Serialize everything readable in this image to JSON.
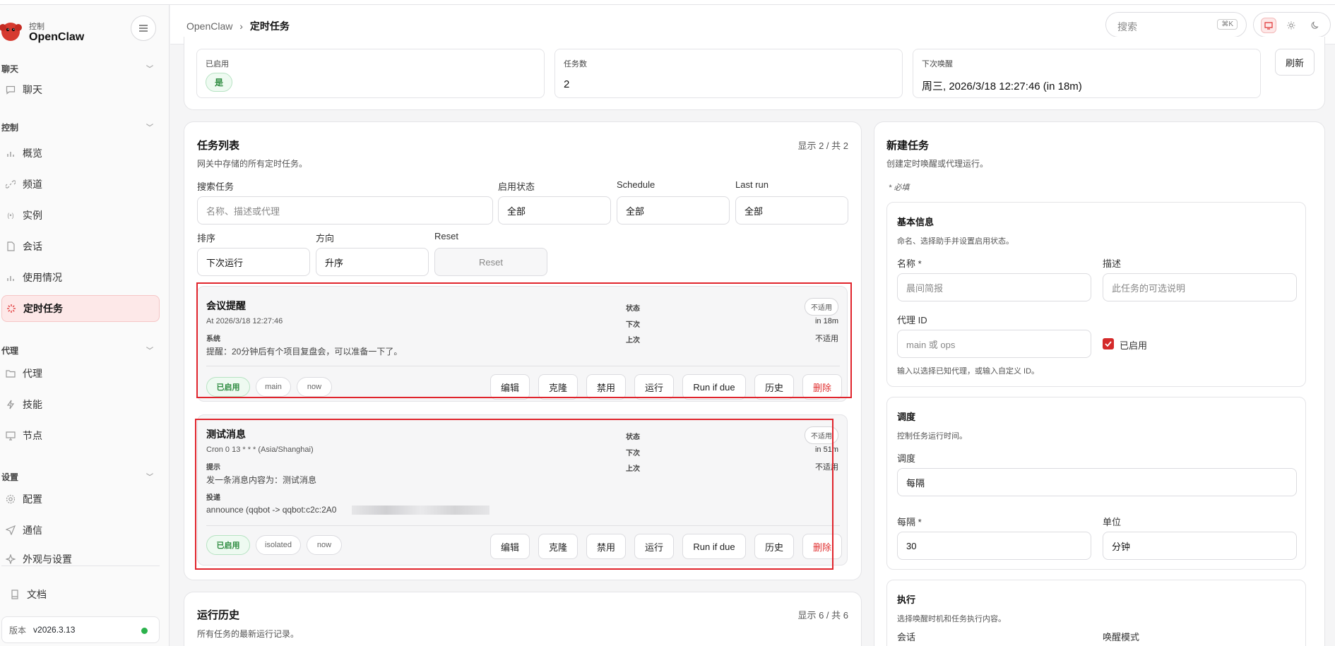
{
  "brand": {
    "sub": "控制",
    "name": "OpenClaw"
  },
  "sidebar": {
    "sections": [
      {
        "label": "聊天",
        "items": [
          {
            "label": "聊天",
            "icon": "chat-icon"
          }
        ]
      },
      {
        "label": "控制",
        "items": [
          {
            "label": "概览",
            "icon": "bar-chart-icon"
          },
          {
            "label": "频道",
            "icon": "link-icon"
          },
          {
            "label": "实例",
            "icon": "broadcast-icon"
          },
          {
            "label": "会话",
            "icon": "document-icon"
          },
          {
            "label": "使用情况",
            "icon": "bar-chart-icon"
          },
          {
            "label": "定时任务",
            "icon": "loader-icon",
            "active": true
          }
        ]
      },
      {
        "label": "代理",
        "items": [
          {
            "label": "代理",
            "icon": "folder-icon"
          },
          {
            "label": "技能",
            "icon": "lightning-icon"
          },
          {
            "label": "节点",
            "icon": "monitor-icon"
          }
        ]
      },
      {
        "label": "设置",
        "items": [
          {
            "label": "配置",
            "icon": "gear-icon"
          },
          {
            "label": "通信",
            "icon": "send-icon"
          },
          {
            "label": "外观与设置",
            "icon": "sparkle-icon"
          }
        ]
      }
    ],
    "docs": "文档",
    "version_label": "版本",
    "version": "v2026.3.13"
  },
  "topbar": {
    "breadcrumb_root": "OpenClaw",
    "breadcrumb_sep": "›",
    "breadcrumb_current": "定时任务",
    "search_placeholder": "搜索",
    "search_shortcut": "⌘K"
  },
  "status": {
    "enabled_label": "已启用",
    "enabled_value": "是",
    "jobs_label": "任务数",
    "jobs_value": "2",
    "next_wake_label": "下次唤醒",
    "next_wake_value": "周三, 2026/3/18 12:27:46 (in 18m)",
    "refresh": "刷新"
  },
  "tasks": {
    "title": "任务列表",
    "subtitle": "网关中存储的所有定时任务。",
    "count": "显示 2 / 共 2",
    "filters": {
      "search_label": "搜索任务",
      "search_placeholder": "名称、描述或代理",
      "enabled_label": "启用状态",
      "enabled_value": "全部",
      "schedule_label": "Schedule",
      "schedule_value": "全部",
      "lastrun_label": "Last run",
      "lastrun_value": "全部",
      "sort_label": "排序",
      "sort_value": "下次运行",
      "dir_label": "方向",
      "dir_value": "升序",
      "reset_label": "Reset",
      "reset_button": "Reset"
    },
    "jobs": [
      {
        "title": "会议提醒",
        "schedule": "At 2026/3/18 12:27:46",
        "kind_label": "系统",
        "text": "提醒：20分钟后有个项目复盘会，可以准备一下了。",
        "state_label": "状态",
        "state": "不适用",
        "next_label": "下次",
        "next": "in 18m",
        "last_label": "上次",
        "last": "不适用",
        "tags": [
          "已启用",
          "main",
          "now"
        ]
      },
      {
        "title": "测试消息",
        "schedule": "Cron 0 13 * * * (Asia/Shanghai)",
        "kind_label": "提示",
        "text": "发一条消息内容为：测试消息",
        "delivery_label": "投递",
        "delivery": "announce (qqbot -> qqbot:c2c:2A0",
        "state_label": "状态",
        "state": "不适用",
        "next_label": "下次",
        "next": "in 51m",
        "last_label": "上次",
        "last": "不适用",
        "tags": [
          "已启用",
          "isolated",
          "now"
        ]
      }
    ],
    "actions": [
      "编辑",
      "克隆",
      "禁用",
      "运行",
      "Run if due",
      "历史",
      "删除"
    ]
  },
  "history": {
    "title": "运行历史",
    "subtitle": "所有任务的最新运行记录。",
    "count": "显示 6 / 共 6"
  },
  "new_task": {
    "title": "新建任务",
    "subtitle": "创建定时唤醒或代理运行。",
    "required": "* 必填",
    "basic": {
      "title": "基本信息",
      "subtitle": "命名、选择助手并设置启用状态。",
      "name_label": "名称",
      "name_req": "*",
      "name_placeholder": "晨间简报",
      "desc_label": "描述",
      "desc_placeholder": "此任务的可选说明",
      "agent_label": "代理 ID",
      "agent_placeholder": "main 或 ops",
      "enabled_label": "已启用",
      "hint": "输入以选择已知代理，或输入自定义 ID。"
    },
    "schedule": {
      "title": "调度",
      "subtitle": "控制任务运行时间。",
      "kind_label": "调度",
      "kind_value": "每隔",
      "every_label": "每隔",
      "every_req": "*",
      "every_value": "30",
      "unit_label": "单位",
      "unit_value": "分钟"
    },
    "exec": {
      "title": "执行",
      "subtitle": "选择唤醒时机和任务执行内容。",
      "session_label": "会话",
      "wake_label": "唤醒模式"
    }
  },
  "colors": {
    "accent": "#e03131",
    "success": "#2b8a3e",
    "highlight": "#e0242c"
  }
}
